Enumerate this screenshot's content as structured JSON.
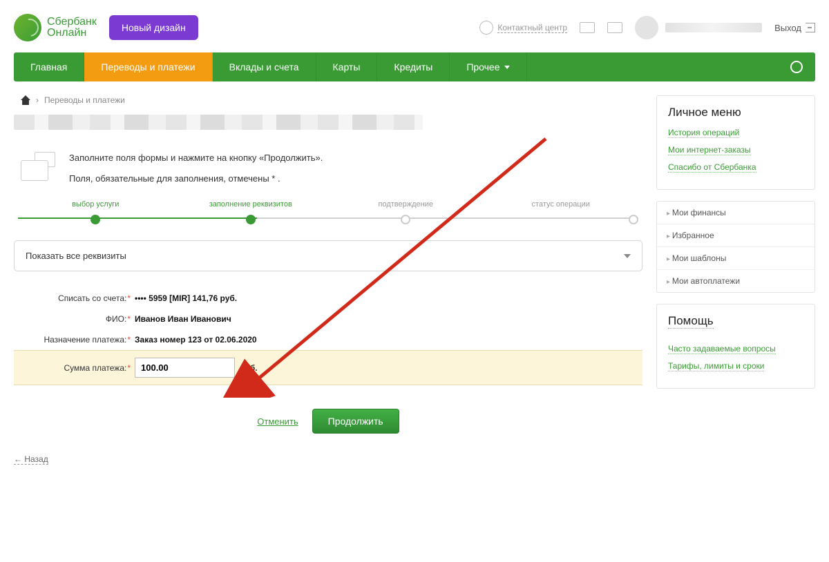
{
  "header": {
    "logo_line1": "Сбербанк",
    "logo_line2": "Онлайн",
    "new_design_btn": "Новый дизайн",
    "contact_center": "Контактный центр",
    "exit": "Выход"
  },
  "nav": {
    "items": [
      "Главная",
      "Переводы и платежи",
      "Вклады и счета",
      "Карты",
      "Кредиты",
      "Прочее"
    ],
    "active_index": 1
  },
  "breadcrumb": {
    "current": "Переводы и платежи"
  },
  "instructions": {
    "line1": "Заполните поля формы и нажмите на кнопку «Продолжить».",
    "line2": "Поля, обязательные для заполнения, отмечены * ."
  },
  "steps": {
    "items": [
      "выбор услуги",
      "заполнение реквизитов",
      "подтверждение",
      "статус операции"
    ],
    "current": 1
  },
  "expand_label": "Показать все реквизиты",
  "form": {
    "account_label": "Списать со счета:",
    "account_value": "•••• 5959  [MIR] 141,76   руб.",
    "fio_label": "ФИО:",
    "fio_value": "Иванов Иван Иванович",
    "purpose_label": "Назначение платежа:",
    "purpose_value": "Заказ номер 123 от 02.06.2020",
    "amount_label": "Сумма платежа:",
    "amount_value": "100.00",
    "amount_unit": "руб."
  },
  "actions": {
    "cancel": "Отменить",
    "continue": "Продолжить",
    "back": "Назад"
  },
  "sidebar": {
    "personal_menu_title": "Личное меню",
    "personal_links": [
      "История операций",
      "Мои интернет-заказы",
      "Спасибо от Сбербанка"
    ],
    "sections": [
      "Мои финансы",
      "Избранное",
      "Мои шаблоны",
      "Мои автоплатежи"
    ],
    "help_title": "Помощь",
    "help_links": [
      "Часто задаваемые вопросы",
      "Тарифы, лимиты и сроки"
    ]
  }
}
